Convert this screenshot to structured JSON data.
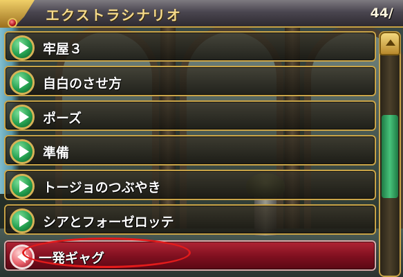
{
  "header": {
    "title": "エクストラシナリオ",
    "counter": "44/"
  },
  "menu": {
    "items": [
      {
        "label": "牢屋３",
        "selected": false
      },
      {
        "label": "自白のさせ方",
        "selected": false
      },
      {
        "label": "ポーズ",
        "selected": false
      },
      {
        "label": "準備",
        "selected": false
      },
      {
        "label": "トージョのつぶやき",
        "selected": false
      },
      {
        "label": "シアとフォーゼロッテ",
        "selected": false
      },
      {
        "label": "一発ギャグ",
        "selected": true
      }
    ]
  },
  "colors": {
    "frame_gold": "#c9a448",
    "title_gold": "#f4d98a",
    "play_green": "#24a050",
    "selected_red": "#b02435",
    "highlight_circle": "#e21b1b",
    "scroll_thumb_green": "#47c27a"
  },
  "icons": {
    "item_button": "play-triangle-icon",
    "selected_button": "back-arrow-icon",
    "scroll_up": "up-arrow-icon"
  }
}
